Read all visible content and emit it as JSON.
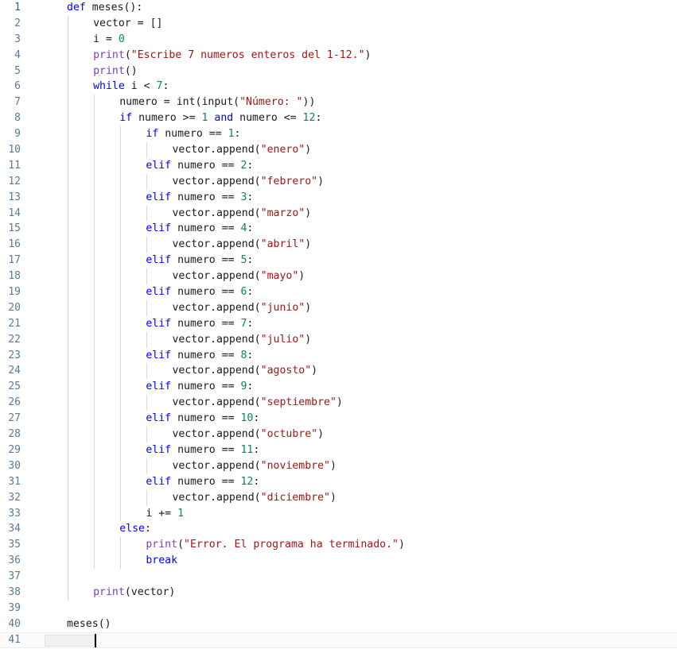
{
  "editor": {
    "language": "Python",
    "total_lines": 41,
    "cursor_line": 41,
    "cursor_column": 5,
    "colors": {
      "background": "#ffffff",
      "keyword": "#0000ff",
      "string": "#a31515",
      "number": "#098658",
      "builtin": "#7b3fbf",
      "identifier": "#1a1a1a",
      "line_number": "#5a7a9a",
      "indent_guide": "#d7d7d7",
      "current_line": "#fbfbfb",
      "caret": "#000000"
    },
    "lines": [
      {
        "n": "1",
        "indent": 0,
        "tokens": [
          {
            "t": "def",
            "c": "kw"
          },
          {
            "t": " meses():",
            "c": "id"
          }
        ]
      },
      {
        "n": "2",
        "indent": 1,
        "tokens": [
          {
            "t": "vector = []",
            "c": "id"
          }
        ]
      },
      {
        "n": "3",
        "indent": 1,
        "tokens": [
          {
            "t": "i = ",
            "c": "id"
          },
          {
            "t": "0",
            "c": "num"
          }
        ]
      },
      {
        "n": "4",
        "indent": 1,
        "tokens": [
          {
            "t": "print",
            "c": "bi"
          },
          {
            "t": "(",
            "c": "op"
          },
          {
            "t": "\"Escribe 7 numeros enteros del 1-12.\"",
            "c": "str"
          },
          {
            "t": ")",
            "c": "op"
          }
        ]
      },
      {
        "n": "5",
        "indent": 1,
        "tokens": [
          {
            "t": "print",
            "c": "bi"
          },
          {
            "t": "()",
            "c": "op"
          }
        ]
      },
      {
        "n": "6",
        "indent": 1,
        "tokens": [
          {
            "t": "while",
            "c": "kw"
          },
          {
            "t": " i < ",
            "c": "id"
          },
          {
            "t": "7",
            "c": "num"
          },
          {
            "t": ":",
            "c": "op"
          }
        ]
      },
      {
        "n": "7",
        "indent": 2,
        "tokens": [
          {
            "t": "numero = int(input(",
            "c": "id"
          },
          {
            "t": "\"Número: \"",
            "c": "str"
          },
          {
            "t": "))",
            "c": "op"
          }
        ]
      },
      {
        "n": "8",
        "indent": 2,
        "tokens": [
          {
            "t": "if",
            "c": "kw"
          },
          {
            "t": " numero >= ",
            "c": "id"
          },
          {
            "t": "1",
            "c": "num"
          },
          {
            "t": " ",
            "c": "id"
          },
          {
            "t": "and",
            "c": "kw"
          },
          {
            "t": " numero <= ",
            "c": "id"
          },
          {
            "t": "12",
            "c": "num"
          },
          {
            "t": ":",
            "c": "op"
          }
        ]
      },
      {
        "n": "9",
        "indent": 3,
        "tokens": [
          {
            "t": "if",
            "c": "kw"
          },
          {
            "t": " numero == ",
            "c": "id"
          },
          {
            "t": "1",
            "c": "num"
          },
          {
            "t": ":",
            "c": "op"
          }
        ]
      },
      {
        "n": "10",
        "indent": 4,
        "tokens": [
          {
            "t": "vector.append(",
            "c": "id"
          },
          {
            "t": "\"enero\"",
            "c": "str"
          },
          {
            "t": ")",
            "c": "op"
          }
        ]
      },
      {
        "n": "11",
        "indent": 3,
        "tokens": [
          {
            "t": "elif",
            "c": "kw"
          },
          {
            "t": " numero == ",
            "c": "id"
          },
          {
            "t": "2",
            "c": "num"
          },
          {
            "t": ":",
            "c": "op"
          }
        ]
      },
      {
        "n": "12",
        "indent": 4,
        "tokens": [
          {
            "t": "vector.append(",
            "c": "id"
          },
          {
            "t": "\"febrero\"",
            "c": "str"
          },
          {
            "t": ")",
            "c": "op"
          }
        ]
      },
      {
        "n": "13",
        "indent": 3,
        "tokens": [
          {
            "t": "elif",
            "c": "kw"
          },
          {
            "t": " numero == ",
            "c": "id"
          },
          {
            "t": "3",
            "c": "num"
          },
          {
            "t": ":",
            "c": "op"
          }
        ]
      },
      {
        "n": "14",
        "indent": 4,
        "tokens": [
          {
            "t": "vector.append(",
            "c": "id"
          },
          {
            "t": "\"marzo\"",
            "c": "str"
          },
          {
            "t": ")",
            "c": "op"
          }
        ]
      },
      {
        "n": "15",
        "indent": 3,
        "tokens": [
          {
            "t": "elif",
            "c": "kw"
          },
          {
            "t": " numero == ",
            "c": "id"
          },
          {
            "t": "4",
            "c": "num"
          },
          {
            "t": ":",
            "c": "op"
          }
        ]
      },
      {
        "n": "16",
        "indent": 4,
        "tokens": [
          {
            "t": "vector.append(",
            "c": "id"
          },
          {
            "t": "\"abril\"",
            "c": "str"
          },
          {
            "t": ")",
            "c": "op"
          }
        ]
      },
      {
        "n": "17",
        "indent": 3,
        "tokens": [
          {
            "t": "elif",
            "c": "kw"
          },
          {
            "t": " numero == ",
            "c": "id"
          },
          {
            "t": "5",
            "c": "num"
          },
          {
            "t": ":",
            "c": "op"
          }
        ]
      },
      {
        "n": "18",
        "indent": 4,
        "tokens": [
          {
            "t": "vector.append(",
            "c": "id"
          },
          {
            "t": "\"mayo\"",
            "c": "str"
          },
          {
            "t": ")",
            "c": "op"
          }
        ]
      },
      {
        "n": "19",
        "indent": 3,
        "tokens": [
          {
            "t": "elif",
            "c": "kw"
          },
          {
            "t": " numero == ",
            "c": "id"
          },
          {
            "t": "6",
            "c": "num"
          },
          {
            "t": ":",
            "c": "op"
          }
        ]
      },
      {
        "n": "20",
        "indent": 4,
        "tokens": [
          {
            "t": "vector.append(",
            "c": "id"
          },
          {
            "t": "\"junio\"",
            "c": "str"
          },
          {
            "t": ")",
            "c": "op"
          }
        ]
      },
      {
        "n": "21",
        "indent": 3,
        "tokens": [
          {
            "t": "elif",
            "c": "kw"
          },
          {
            "t": " numero == ",
            "c": "id"
          },
          {
            "t": "7",
            "c": "num"
          },
          {
            "t": ":",
            "c": "op"
          }
        ]
      },
      {
        "n": "22",
        "indent": 4,
        "tokens": [
          {
            "t": "vector.append(",
            "c": "id"
          },
          {
            "t": "\"julio\"",
            "c": "str"
          },
          {
            "t": ")",
            "c": "op"
          }
        ]
      },
      {
        "n": "23",
        "indent": 3,
        "tokens": [
          {
            "t": "elif",
            "c": "kw"
          },
          {
            "t": " numero == ",
            "c": "id"
          },
          {
            "t": "8",
            "c": "num"
          },
          {
            "t": ":",
            "c": "op"
          }
        ]
      },
      {
        "n": "24",
        "indent": 4,
        "tokens": [
          {
            "t": "vector.append(",
            "c": "id"
          },
          {
            "t": "\"agosto\"",
            "c": "str"
          },
          {
            "t": ")",
            "c": "op"
          }
        ]
      },
      {
        "n": "25",
        "indent": 3,
        "tokens": [
          {
            "t": "elif",
            "c": "kw"
          },
          {
            "t": " numero == ",
            "c": "id"
          },
          {
            "t": "9",
            "c": "num"
          },
          {
            "t": ":",
            "c": "op"
          }
        ]
      },
      {
        "n": "26",
        "indent": 4,
        "tokens": [
          {
            "t": "vector.append(",
            "c": "id"
          },
          {
            "t": "\"septiembre\"",
            "c": "str"
          },
          {
            "t": ")",
            "c": "op"
          }
        ]
      },
      {
        "n": "27",
        "indent": 3,
        "tokens": [
          {
            "t": "elif",
            "c": "kw"
          },
          {
            "t": " numero == ",
            "c": "id"
          },
          {
            "t": "10",
            "c": "num"
          },
          {
            "t": ":",
            "c": "op"
          }
        ]
      },
      {
        "n": "28",
        "indent": 4,
        "tokens": [
          {
            "t": "vector.append(",
            "c": "id"
          },
          {
            "t": "\"octubre\"",
            "c": "str"
          },
          {
            "t": ")",
            "c": "op"
          }
        ]
      },
      {
        "n": "29",
        "indent": 3,
        "tokens": [
          {
            "t": "elif",
            "c": "kw"
          },
          {
            "t": " numero == ",
            "c": "id"
          },
          {
            "t": "11",
            "c": "num"
          },
          {
            "t": ":",
            "c": "op"
          }
        ]
      },
      {
        "n": "30",
        "indent": 4,
        "tokens": [
          {
            "t": "vector.append(",
            "c": "id"
          },
          {
            "t": "\"noviembre\"",
            "c": "str"
          },
          {
            "t": ")",
            "c": "op"
          }
        ]
      },
      {
        "n": "31",
        "indent": 3,
        "tokens": [
          {
            "t": "elif",
            "c": "kw"
          },
          {
            "t": " numero == ",
            "c": "id"
          },
          {
            "t": "12",
            "c": "num"
          },
          {
            "t": ":",
            "c": "op"
          }
        ]
      },
      {
        "n": "32",
        "indent": 4,
        "tokens": [
          {
            "t": "vector.append(",
            "c": "id"
          },
          {
            "t": "\"diciembre\"",
            "c": "str"
          },
          {
            "t": ")",
            "c": "op"
          }
        ]
      },
      {
        "n": "33",
        "indent": 3,
        "tokens": [
          {
            "t": "i += ",
            "c": "id"
          },
          {
            "t": "1",
            "c": "num"
          }
        ]
      },
      {
        "n": "34",
        "indent": 2,
        "tokens": [
          {
            "t": "else",
            "c": "kw"
          },
          {
            "t": ":",
            "c": "op"
          }
        ]
      },
      {
        "n": "35",
        "indent": 3,
        "tokens": [
          {
            "t": "print",
            "c": "bi"
          },
          {
            "t": "(",
            "c": "op"
          },
          {
            "t": "\"Error. El programa ha terminado.\"",
            "c": "str"
          },
          {
            "t": ")",
            "c": "op"
          }
        ]
      },
      {
        "n": "36",
        "indent": 3,
        "tokens": [
          {
            "t": "break",
            "c": "kw"
          }
        ]
      },
      {
        "n": "37",
        "indent": 0,
        "tokens": []
      },
      {
        "n": "38",
        "indent": 1,
        "tokens": [
          {
            "t": "print",
            "c": "bi"
          },
          {
            "t": "(vector)",
            "c": "op"
          }
        ]
      },
      {
        "n": "39",
        "indent": 0,
        "tokens": []
      },
      {
        "n": "40",
        "indent": 0,
        "tokens": [
          {
            "t": "meses()",
            "c": "id"
          }
        ]
      },
      {
        "n": "41",
        "indent": 0,
        "tokens": [],
        "current": true
      }
    ]
  }
}
